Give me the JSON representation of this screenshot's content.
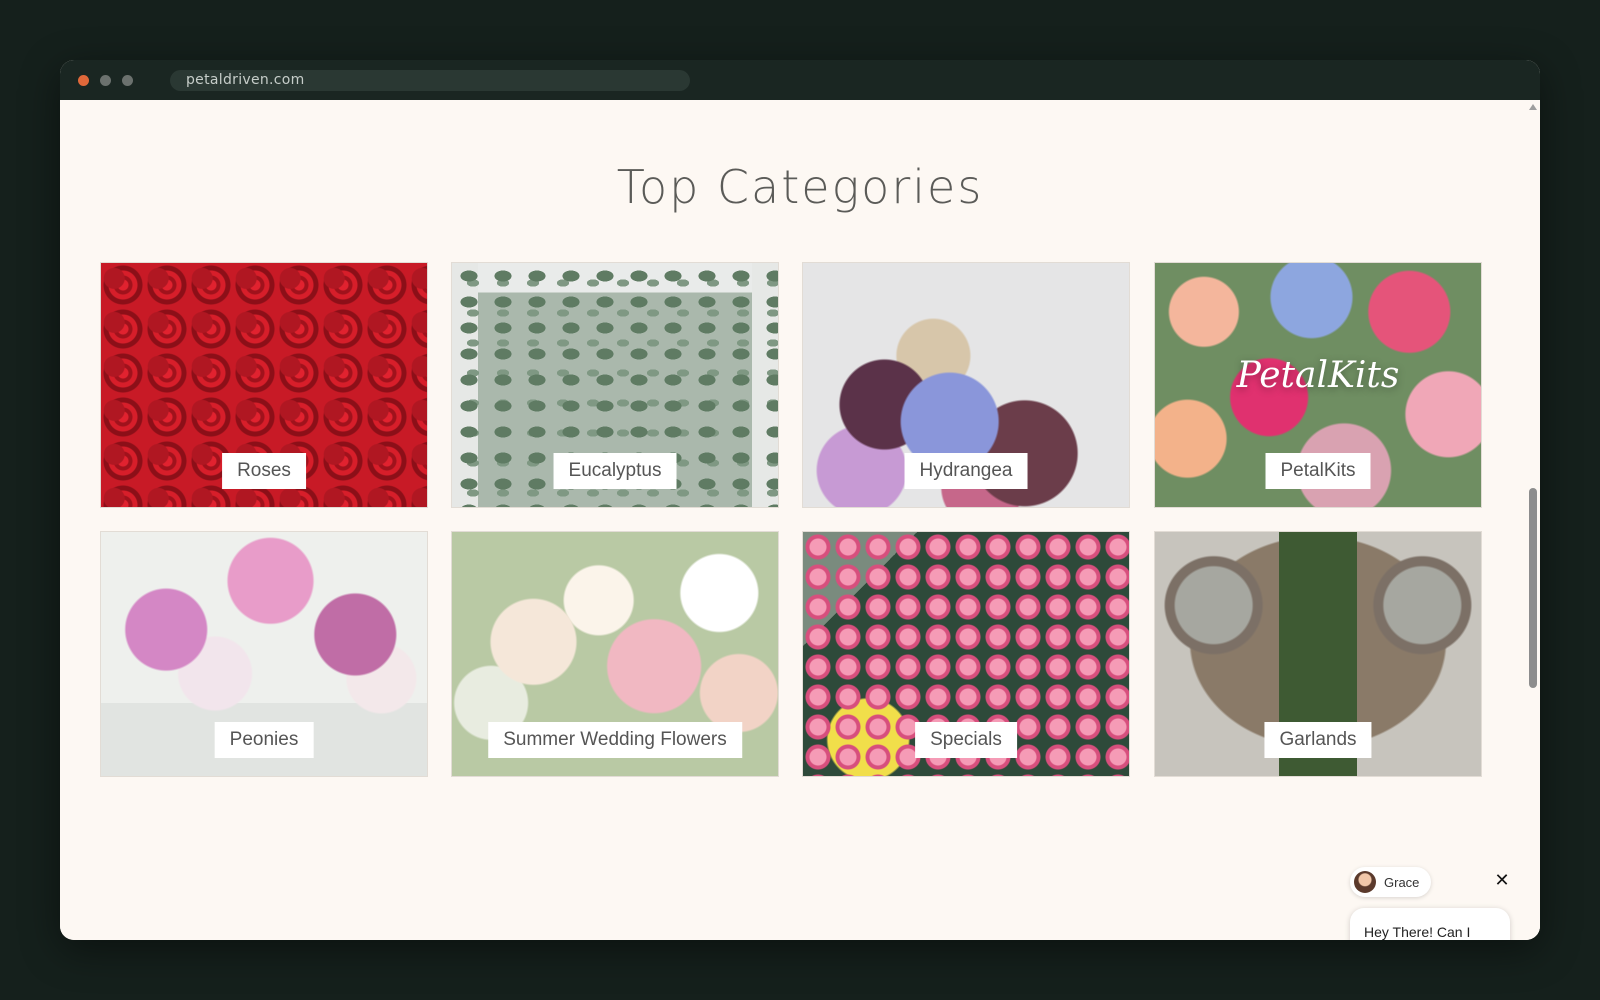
{
  "browser": {
    "url": "petaldriven.com"
  },
  "page": {
    "heading": "Top Categories",
    "categories": [
      {
        "label": "Roses",
        "overlay": ""
      },
      {
        "label": "Eucalyptus",
        "overlay": ""
      },
      {
        "label": "Hydrangea",
        "overlay": ""
      },
      {
        "label": "PetalKits",
        "overlay": "PetalKits"
      },
      {
        "label": "Peonies",
        "overlay": ""
      },
      {
        "label": "Summer Wedding Flowers",
        "overlay": ""
      },
      {
        "label": "Specials",
        "overlay": ""
      },
      {
        "label": "Garlands",
        "overlay": ""
      }
    ]
  },
  "chat": {
    "agent_name": "Grace",
    "message": "Hey There! Can I",
    "close_icon": "close-icon"
  },
  "colors": {
    "page_background": "#fdf8f3",
    "titlebar": "#1a2622",
    "heading_text": "#5b5b58",
    "close_dot": "#e0683a"
  }
}
